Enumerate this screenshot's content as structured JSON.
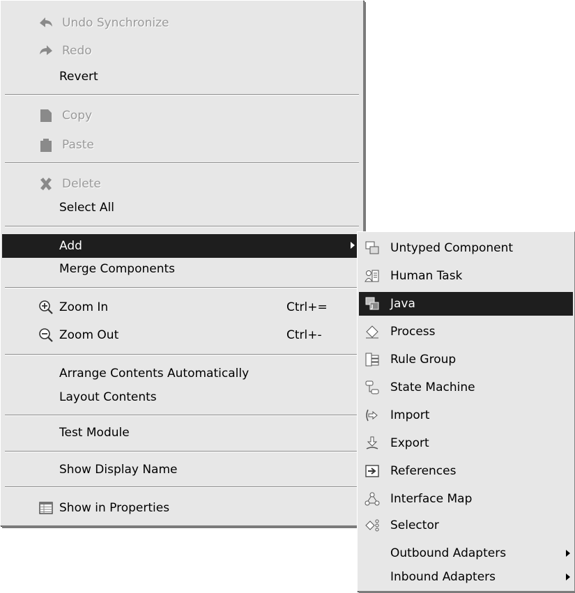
{
  "main_menu": {
    "undo": {
      "label": "Undo Synchronize",
      "icon": "undo-icon",
      "enabled": false
    },
    "redo": {
      "label": "Redo",
      "icon": "redo-icon",
      "enabled": false
    },
    "revert": {
      "label": "Revert"
    },
    "copy": {
      "label": "Copy",
      "icon": "copy-icon",
      "enabled": false
    },
    "paste": {
      "label": "Paste",
      "icon": "paste-icon",
      "enabled": false
    },
    "delete": {
      "label": "Delete",
      "icon": "delete-icon",
      "enabled": false
    },
    "select_all": {
      "label": "Select All"
    },
    "add": {
      "label": "Add",
      "highlighted": true,
      "has_submenu": true
    },
    "merge": {
      "label": "Merge Components"
    },
    "zoom_in": {
      "label": "Zoom In",
      "shortcut": "Ctrl+=",
      "icon": "zoom-in-icon"
    },
    "zoom_out": {
      "label": "Zoom Out",
      "shortcut": "Ctrl+-",
      "icon": "zoom-out-icon"
    },
    "arrange": {
      "label": "Arrange Contents Automatically"
    },
    "layout": {
      "label": "Layout Contents"
    },
    "test_module": {
      "label": "Test Module"
    },
    "show_display_name": {
      "label": "Show Display Name"
    },
    "show_in_properties": {
      "label": "Show in Properties",
      "icon": "properties-table-icon"
    }
  },
  "add_submenu": {
    "untyped": {
      "label": "Untyped Component",
      "icon": "untyped-component-icon"
    },
    "human_task": {
      "label": "Human Task",
      "icon": "human-task-icon"
    },
    "java": {
      "label": "Java",
      "icon": "java-component-icon",
      "highlighted": true
    },
    "process": {
      "label": "Process",
      "icon": "process-icon"
    },
    "rule_group": {
      "label": "Rule Group",
      "icon": "rule-group-icon"
    },
    "state_machine": {
      "label": "State Machine",
      "icon": "state-machine-icon"
    },
    "import": {
      "label": "Import",
      "icon": "import-icon"
    },
    "export": {
      "label": "Export",
      "icon": "export-icon"
    },
    "references": {
      "label": "References",
      "icon": "references-icon"
    },
    "interface_map": {
      "label": "Interface Map",
      "icon": "interface-map-icon"
    },
    "selector": {
      "label": "Selector",
      "icon": "selector-icon"
    },
    "outbound": {
      "label": "Outbound Adapters",
      "has_submenu": true
    },
    "inbound": {
      "label": "Inbound Adapters",
      "has_submenu": true
    }
  },
  "colors": {
    "menu_bg": "#e7e7e7",
    "highlight_bg": "#1e1e1e",
    "disabled_text": "#9a9a9a"
  }
}
